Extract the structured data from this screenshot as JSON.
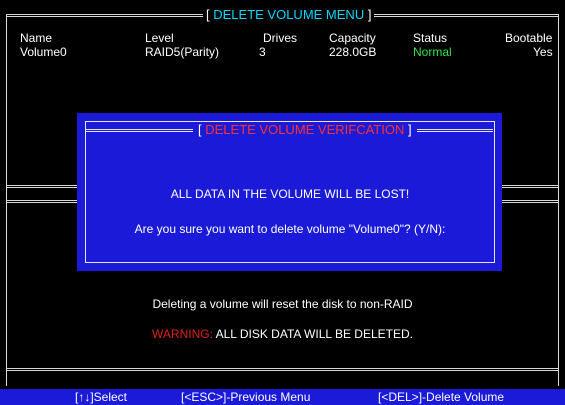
{
  "menu": {
    "title_open": "[ ",
    "title": "DELETE VOLUME MENU",
    "title_close": " ]"
  },
  "volume_table": {
    "headers": {
      "name": "Name",
      "level": "Level",
      "drives": "Drives",
      "capacity": "Capacity",
      "status": "Status",
      "bootable": "Bootable"
    },
    "rows": [
      {
        "name": "Volume0",
        "level": "RAID5(Parity)",
        "drives": "3",
        "capacity": "228.0GB",
        "status": "Normal",
        "bootable": "Yes"
      }
    ]
  },
  "dialog": {
    "title_open": "[ ",
    "title": "DELETE VOLUME VERIFCATION",
    "title_close": " ]",
    "message": "ALL DATA IN THE VOLUME WILL BE LOST!",
    "prompt": "Are you sure you want to delete volume \"Volume0\"? (Y/N):"
  },
  "info": {
    "note": "Deleting a volume will reset the disk to non-RAID",
    "warning_label": "WARNING:",
    "warning_text": "ALL DISK DATA WILL BE DELETED."
  },
  "statusbar": {
    "select": "[↑↓]Select",
    "esc": "[<ESC>]-Previous Menu",
    "del": "[<DEL>]-Delete Volume"
  },
  "colors": {
    "background": "#000000",
    "title_cyan": "#00d8ff",
    "status_normal": "#2ee64b",
    "dialog_blue": "#1a1ad8",
    "warning_red": "#e02020"
  }
}
